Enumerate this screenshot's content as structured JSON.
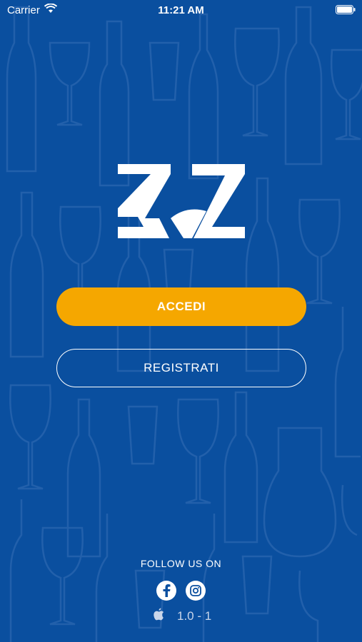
{
  "status_bar": {
    "carrier": "Carrier",
    "time": "11:21 AM"
  },
  "logo": {
    "icon": "sommelier-logo-icon"
  },
  "actions": {
    "login_label": "ACCEDI",
    "register_label": "REGISTRATI"
  },
  "footer": {
    "follow_label": "FOLLOW US ON",
    "social": [
      {
        "icon": "facebook-icon"
      },
      {
        "icon": "instagram-icon"
      }
    ],
    "platform_icon": "apple-icon",
    "version": "1.0 - 1"
  },
  "colors": {
    "background": "#0a4f9f",
    "primary_button": "#f5a700",
    "text": "#ffffff"
  }
}
